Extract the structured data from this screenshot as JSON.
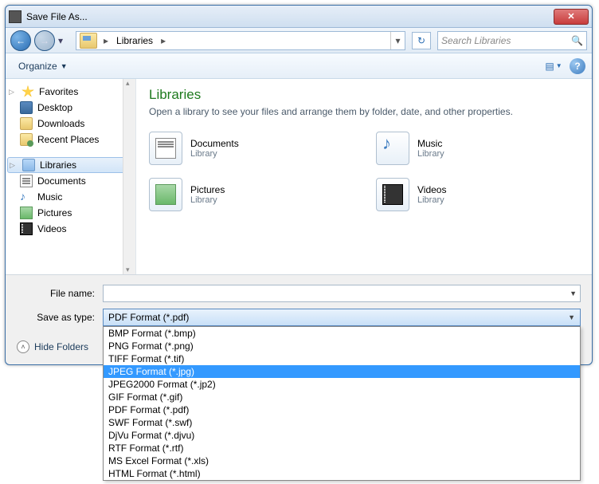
{
  "title": "Save File As...",
  "breadcrumb": {
    "location": "Libraries"
  },
  "search": {
    "placeholder": "Search Libraries"
  },
  "toolbar": {
    "organize": "Organize"
  },
  "sidebar": {
    "favorites": {
      "label": "Favorites",
      "items": [
        {
          "label": "Desktop"
        },
        {
          "label": "Downloads"
        },
        {
          "label": "Recent Places"
        }
      ]
    },
    "libraries": {
      "label": "Libraries",
      "items": [
        {
          "label": "Documents"
        },
        {
          "label": "Music"
        },
        {
          "label": "Pictures"
        },
        {
          "label": "Videos"
        }
      ]
    }
  },
  "main": {
    "heading": "Libraries",
    "desc": "Open a library to see your files and arrange them by folder, date, and other properties.",
    "itemSubLabel": "Library",
    "items": [
      {
        "label": "Documents"
      },
      {
        "label": "Music"
      },
      {
        "label": "Pictures"
      },
      {
        "label": "Videos"
      }
    ]
  },
  "labels": {
    "filename": "File name:",
    "saveastype": "Save as type:",
    "hideFolders": "Hide Folders"
  },
  "filename_value": "",
  "saveastype": {
    "selected": "PDF Format (*.pdf)",
    "highlighted_index": 3,
    "options": [
      "BMP Format (*.bmp)",
      "PNG Format (*.png)",
      "TIFF Format (*.tif)",
      "JPEG Format (*.jpg)",
      "JPEG2000 Format (*.jp2)",
      "GIF Format (*.gif)",
      "PDF Format (*.pdf)",
      "SWF Format (*.swf)",
      "DjVu Format (*.djvu)",
      "RTF Format (*.rtf)",
      "MS Excel Format (*.xls)",
      "HTML Format (*.html)"
    ]
  }
}
